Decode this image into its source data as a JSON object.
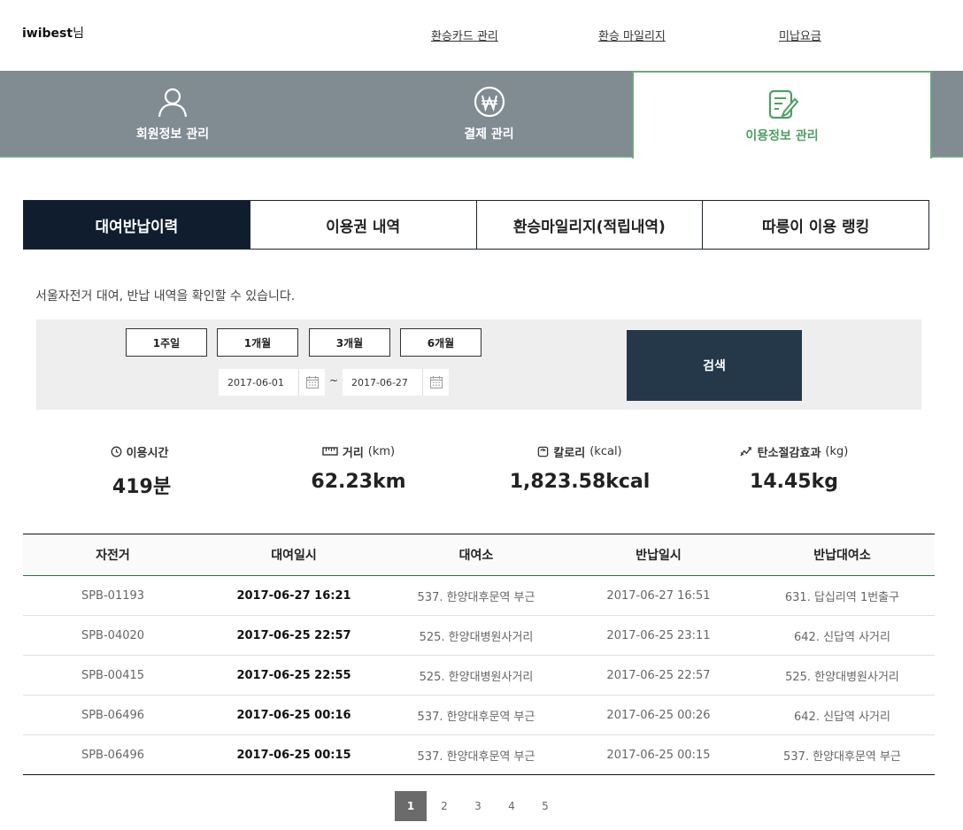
{
  "header": {
    "username": "iwibest",
    "username_suffix": "님",
    "links": [
      "환승카드 관리",
      "환승 마일리지",
      "미납요금"
    ]
  },
  "main_nav": {
    "tabs": [
      {
        "label": "회원정보 관리",
        "icon": "user-icon"
      },
      {
        "label": "결제 관리",
        "icon": "won-icon"
      },
      {
        "label": "이용정보 관리",
        "icon": "edit-note-icon",
        "active": true
      }
    ]
  },
  "sub_tabs": {
    "items": [
      "대여반납이력",
      "이용권 내역",
      "환승마일리지(적립내역)",
      "따릉이 이용 랭킹"
    ],
    "active_index": 0
  },
  "description": "서울자전거 대여, 반납 내역을 확인할 수 있습니다.",
  "search": {
    "period_buttons": [
      "1주일",
      "1개월",
      "3개월",
      "6개월"
    ],
    "start_date": "2017-06-01",
    "end_date": "2017-06-27",
    "separator": "~",
    "search_label": "검색"
  },
  "stats": [
    {
      "label": "이용시간",
      "unit": "",
      "value": "419분",
      "icon": "clock-icon"
    },
    {
      "label": "거리",
      "unit": "(km)",
      "value": "62.23km",
      "icon": "ruler-icon"
    },
    {
      "label": "칼로리",
      "unit": "(kcal)",
      "value": "1,823.58kcal",
      "icon": "scale-icon"
    },
    {
      "label": "탄소절감효과",
      "unit": "(kg)",
      "value": "14.45kg",
      "icon": "trend-icon"
    }
  ],
  "table": {
    "headers": [
      "자전거",
      "대여일시",
      "대여소",
      "반납일시",
      "반납대여소"
    ],
    "rows": [
      [
        "SPB-01193",
        "2017-06-27 16:21",
        "537. 한양대후문역 부근",
        "2017-06-27 16:51",
        "631. 답십리역 1번출구"
      ],
      [
        "SPB-04020",
        "2017-06-25 22:57",
        "525. 한양대병원사거리",
        "2017-06-25 23:11",
        "642. 신답역 사거리"
      ],
      [
        "SPB-00415",
        "2017-06-25 22:55",
        "525. 한양대병원사거리",
        "2017-06-25 22:57",
        "525. 한양대병원사거리"
      ],
      [
        "SPB-06496",
        "2017-06-25 00:16",
        "537. 한양대후문역 부근",
        "2017-06-25 00:26",
        "642. 신답역 사거리"
      ],
      [
        "SPB-06496",
        "2017-06-25 00:15",
        "537. 한양대후문역 부근",
        "2017-06-25 00:15",
        "537. 한양대후문역 부근"
      ]
    ]
  },
  "pagination": {
    "pages": [
      "1",
      "2",
      "3",
      "4",
      "5"
    ],
    "current": "1"
  },
  "colors": {
    "nav_gray": "#808b92",
    "active_green": "#4f9e63",
    "dark_navy": "#0f1d2e",
    "search_navy": "#25384a"
  }
}
